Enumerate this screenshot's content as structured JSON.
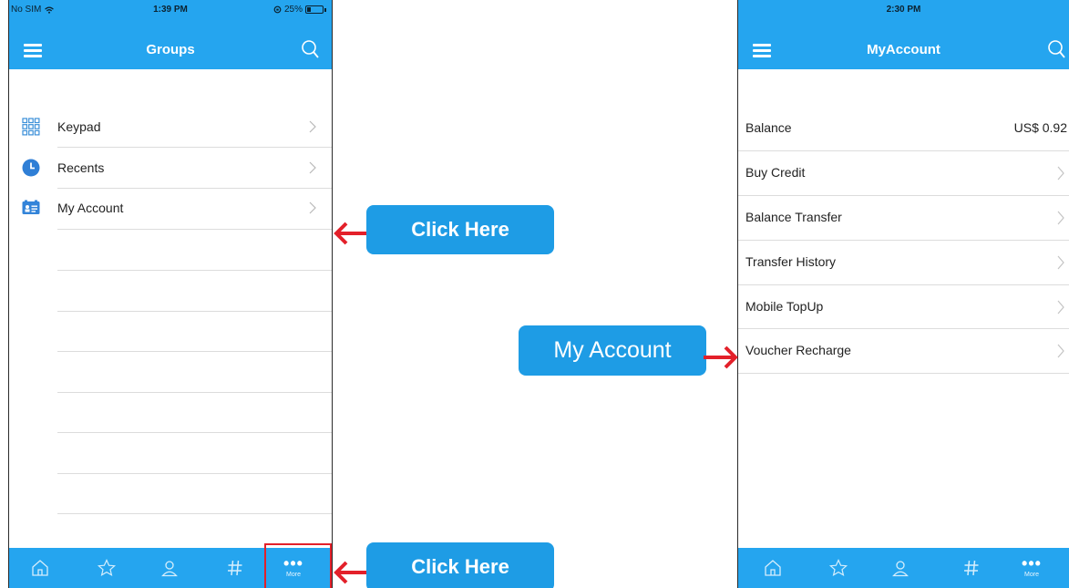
{
  "left_phone": {
    "status": {
      "carrier": "No SIM",
      "time": "1:39 PM",
      "battery": "25%"
    },
    "title": "Groups",
    "menu_items": [
      {
        "label": "Keypad",
        "icon": "keypad-icon"
      },
      {
        "label": "Recents",
        "icon": "clock-icon"
      },
      {
        "label": "My Account",
        "icon": "account-card-icon"
      }
    ],
    "tabs": [
      {
        "icon": "home-icon"
      },
      {
        "icon": "star-icon"
      },
      {
        "icon": "contact-icon"
      },
      {
        "icon": "hash-icon"
      },
      {
        "icon": "more-icon",
        "label": "More"
      }
    ]
  },
  "right_phone": {
    "status": {
      "time": "2:30 PM"
    },
    "title": "MyAccount",
    "balance": {
      "label": "Balance",
      "value": "US$ 0.92"
    },
    "menu_items": [
      {
        "label": "Buy Credit"
      },
      {
        "label": "Balance Transfer"
      },
      {
        "label": "Transfer History"
      },
      {
        "label": "Mobile TopUp"
      },
      {
        "label": "Voucher Recharge"
      }
    ],
    "tabs": [
      {
        "icon": "home-icon"
      },
      {
        "icon": "star-icon"
      },
      {
        "icon": "contact-icon"
      },
      {
        "icon": "hash-icon"
      },
      {
        "icon": "more-icon",
        "label": "More"
      }
    ]
  },
  "callouts": {
    "my_account_callout": "Click Here",
    "more_tab_callout": "Click Here",
    "right_callout": "My Account"
  },
  "colors": {
    "brand_blue": "#25a5ef",
    "callout_blue": "#1e9ce5",
    "arrow_red": "#e3202a"
  }
}
